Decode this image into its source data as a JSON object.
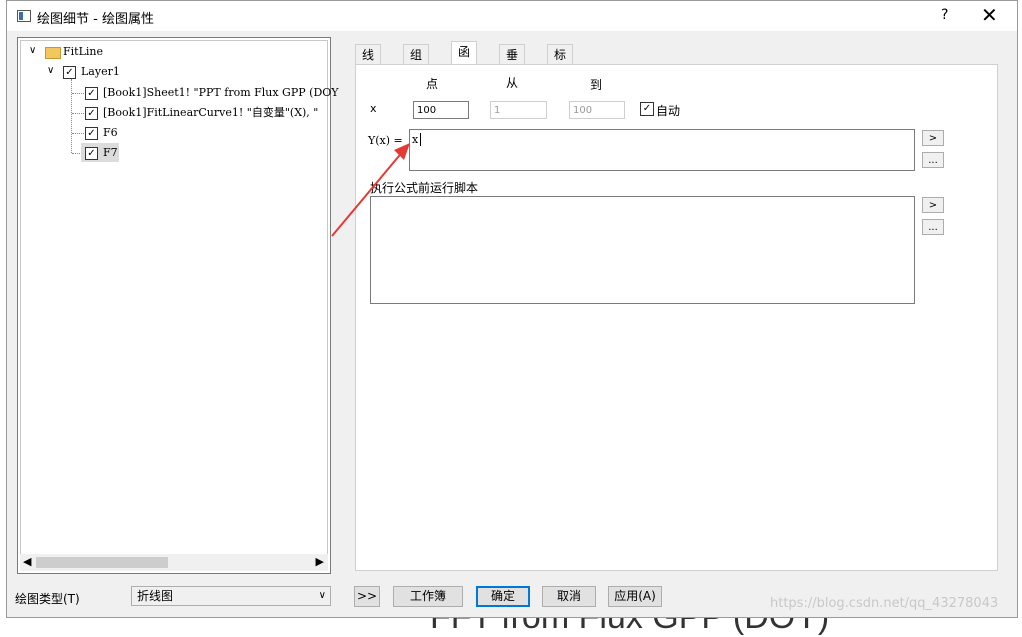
{
  "window": {
    "title": "绘图细节 - 绘图属性",
    "help": "?",
    "close": "✕"
  },
  "tree": {
    "root": "FitLine",
    "layer": "Layer1",
    "items": [
      "[Book1]Sheet1! \"PPT from Flux GPP (DOY",
      "[Book1]FitLinearCurve1! \"自变量\"(X), \"",
      "F6",
      "F7"
    ]
  },
  "tabs": [
    "线条",
    "组图",
    "函数",
    "垂直线",
    "标签"
  ],
  "function_tab": {
    "col_points": "点",
    "col_from": "从",
    "col_to": "到",
    "x_label": "x",
    "points_value": "100",
    "from_value": "1",
    "to_value": "100",
    "auto_label": "自动",
    "yx_label": "Y(x) =",
    "yx_value": "x",
    "script_label": "执行公式前运行脚本",
    "arrow_btn": ">",
    "more_btn": "..."
  },
  "bottom": {
    "plot_type_label": "绘图类型(T)",
    "plot_type_value": "折线图",
    "expand_btn": ">>",
    "workbook_btn": "工作簿",
    "ok_btn": "确定",
    "cancel_btn": "取消",
    "apply_btn": "应用(A)"
  },
  "overlay": {
    "watermark": "https://blog.csdn.net/qq_43278043",
    "background_text": "FFT from Flux GPP (DOY)"
  },
  "colors": {
    "accent": "#0078d7",
    "annotation_arrow": "#e53935"
  }
}
